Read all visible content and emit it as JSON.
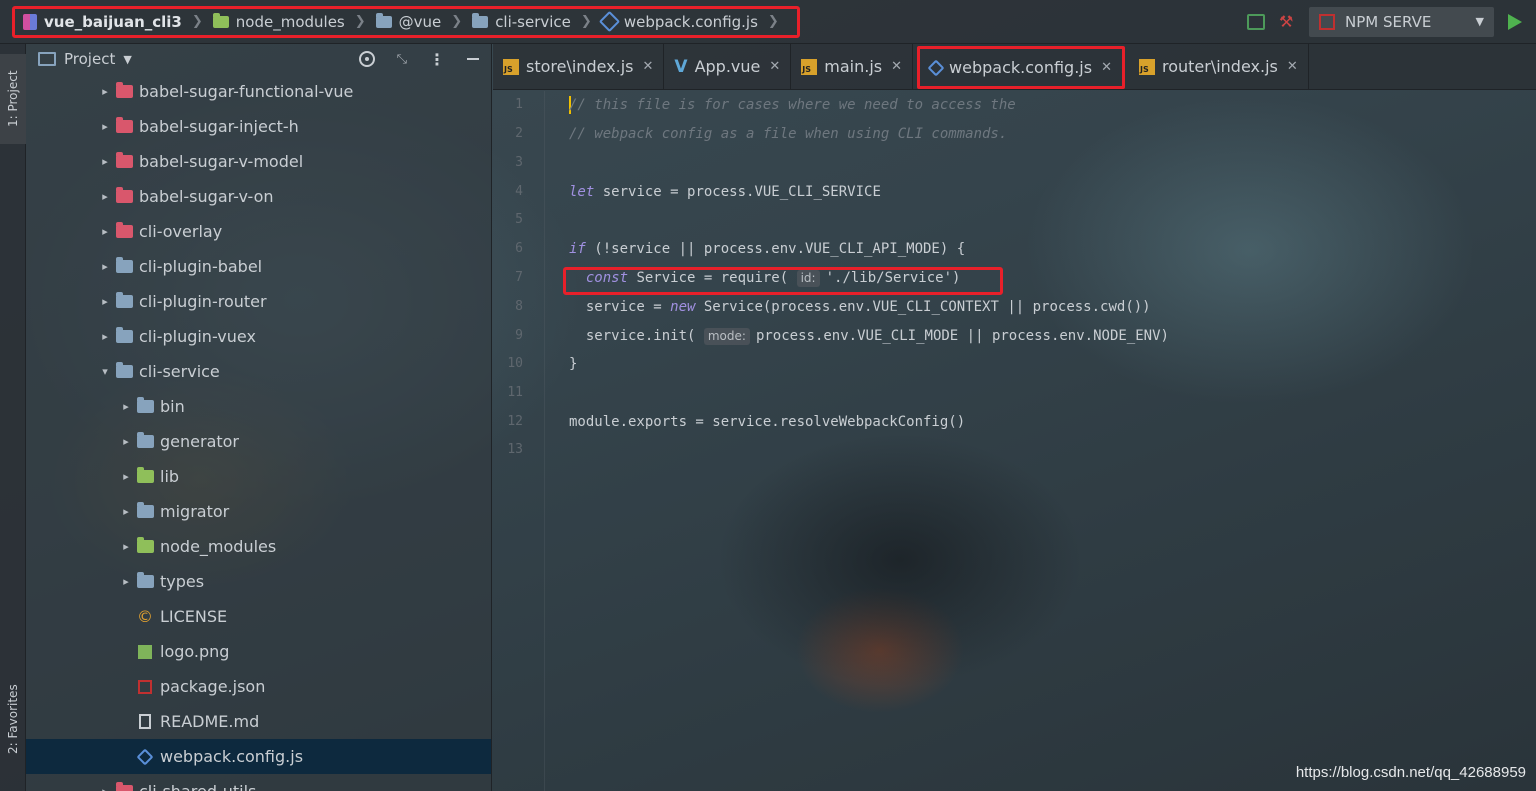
{
  "breadcrumb": {
    "items": [
      {
        "label": "vue_baijuan_cli3",
        "icon": "project-icon"
      },
      {
        "label": "node_modules",
        "icon": "folder-icon"
      },
      {
        "label": "@vue",
        "icon": "folder-icon"
      },
      {
        "label": "cli-service",
        "icon": "folder-icon"
      },
      {
        "label": "webpack.config.js",
        "icon": "webpack-icon"
      }
    ]
  },
  "toolbar": {
    "run_config": "NPM SERVE"
  },
  "leftstrip": {
    "project_tab": "1: Project",
    "favorites_tab": "2: Favorites"
  },
  "panel": {
    "title": "Project"
  },
  "tree": [
    {
      "label": "babel-sugar-functional-vue",
      "type": "folder-red",
      "arrow": "›",
      "indent": 0
    },
    {
      "label": "babel-sugar-inject-h",
      "type": "folder-red",
      "arrow": "›",
      "indent": 0
    },
    {
      "label": "babel-sugar-v-model",
      "type": "folder-red",
      "arrow": "›",
      "indent": 0
    },
    {
      "label": "babel-sugar-v-on",
      "type": "folder-red",
      "arrow": "›",
      "indent": 0
    },
    {
      "label": "cli-overlay",
      "type": "folder-red",
      "arrow": "›",
      "indent": 0
    },
    {
      "label": "cli-plugin-babel",
      "type": "folder-blue",
      "arrow": "›",
      "indent": 0
    },
    {
      "label": "cli-plugin-router",
      "type": "folder-blue",
      "arrow": "›",
      "indent": 0
    },
    {
      "label": "cli-plugin-vuex",
      "type": "folder-blue",
      "arrow": "›",
      "indent": 0
    },
    {
      "label": "cli-service",
      "type": "folder-blue",
      "arrow": "⌄",
      "indent": 0
    },
    {
      "label": "bin",
      "type": "folder-blue",
      "arrow": "›",
      "indent": 1
    },
    {
      "label": "generator",
      "type": "folder-blue",
      "arrow": "›",
      "indent": 1
    },
    {
      "label": "lib",
      "type": "folder-green",
      "arrow": "›",
      "indent": 1
    },
    {
      "label": "migrator",
      "type": "folder-blue",
      "arrow": "›",
      "indent": 1
    },
    {
      "label": "node_modules",
      "type": "folder-green",
      "arrow": "›",
      "indent": 1
    },
    {
      "label": "types",
      "type": "folder-blue",
      "arrow": "›",
      "indent": 1
    },
    {
      "label": "LICENSE",
      "type": "license",
      "arrow": "",
      "indent": 1
    },
    {
      "label": "logo.png",
      "type": "png",
      "arrow": "",
      "indent": 1
    },
    {
      "label": "package.json",
      "type": "pkg",
      "arrow": "",
      "indent": 1
    },
    {
      "label": "README.md",
      "type": "md",
      "arrow": "",
      "indent": 1
    },
    {
      "label": "webpack.config.js",
      "type": "webpack",
      "arrow": "",
      "indent": 1,
      "selected": true
    },
    {
      "label": "cli-shared-utils",
      "type": "folder-red",
      "arrow": "›",
      "indent": 0
    }
  ],
  "tabs": [
    {
      "label": "store\\index.js",
      "icon": "js"
    },
    {
      "label": "App.vue",
      "icon": "vue"
    },
    {
      "label": "main.js",
      "icon": "js"
    },
    {
      "label": "webpack.config.js",
      "icon": "webpack",
      "active": true
    },
    {
      "label": "router\\index.js",
      "icon": "js"
    }
  ],
  "code": {
    "line_numbers": [
      "1",
      "2",
      "3",
      "4",
      "5",
      "6",
      "7",
      "8",
      "9",
      "10",
      "11",
      "12",
      "13"
    ],
    "lines": [
      "// this file is for cases where we need to access the",
      "// webpack config as a file when using CLI commands.",
      "",
      "let service = process.VUE_CLI_SERVICE",
      "",
      "if (!service || process.env.VUE_CLI_API_MODE) {",
      "  const Service = require( id: './lib/Service')",
      "  service = new Service(process.env.VUE_CLI_CONTEXT || process.cwd())",
      "  service.init( mode: process.env.VUE_CLI_MODE || process.env.NODE_ENV)",
      "}",
      "",
      "module.exports = service.resolveWebpackConfig()",
      ""
    ],
    "hint_id": "id:",
    "hint_mode": "mode:"
  },
  "watermark": "https://blog.csdn.net/qq_42688959"
}
